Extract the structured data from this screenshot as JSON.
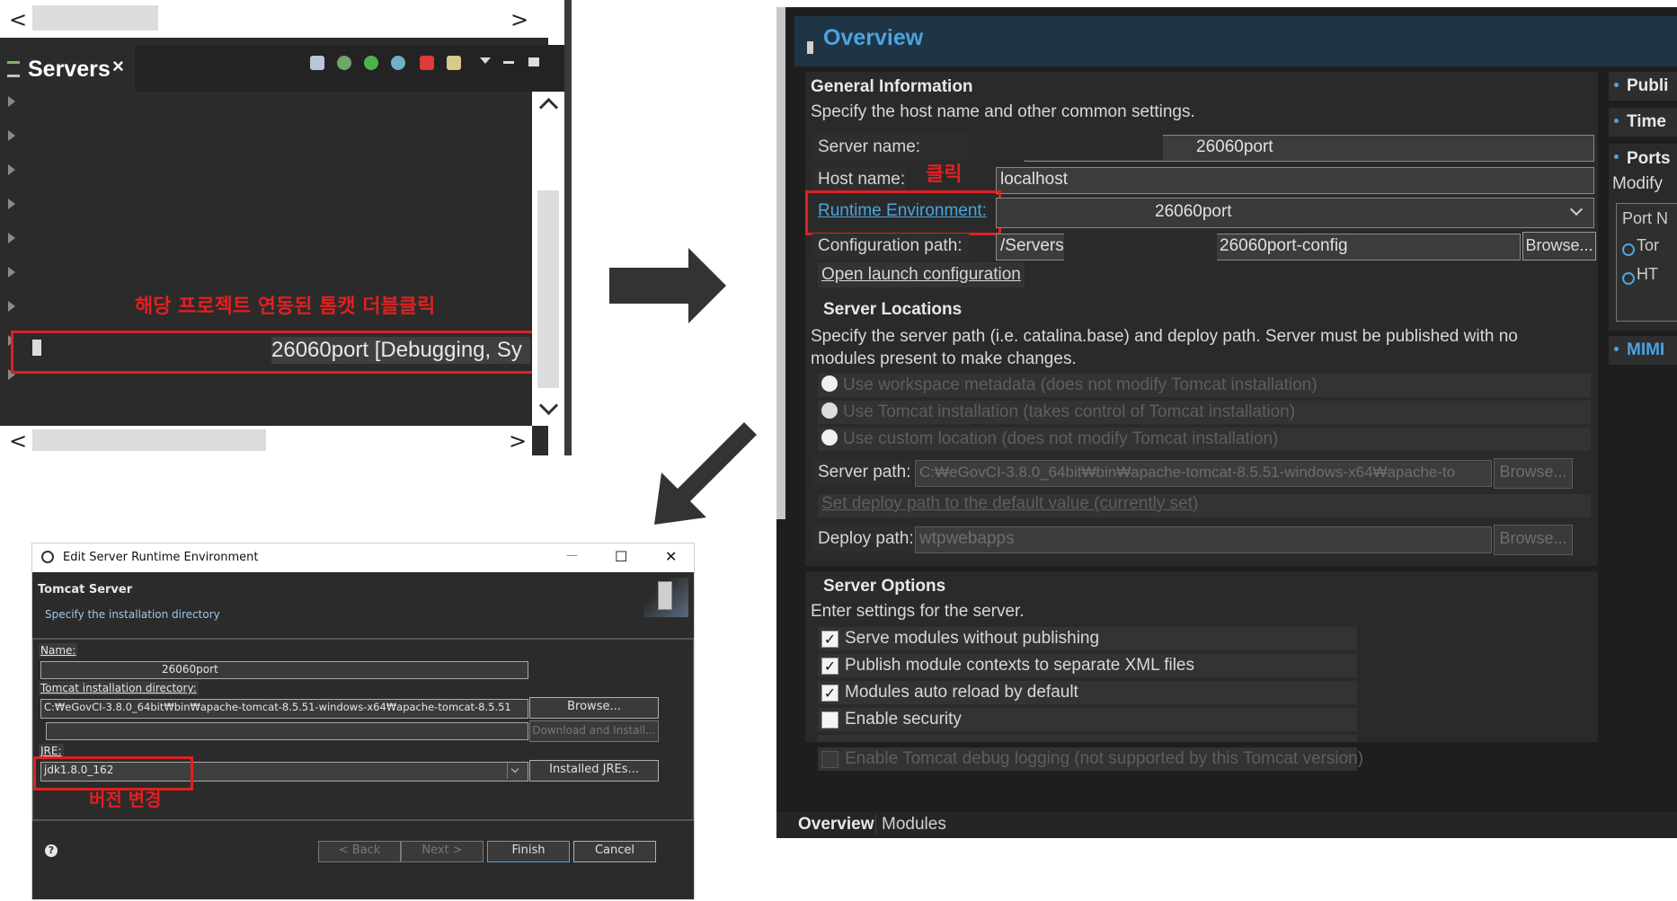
{
  "servers_view": {
    "tab_label": "Servers",
    "tab_close": "×",
    "server_entry": "26060port  [Debugging, Sy",
    "annotation": "해당 프로젝트 연동된 톰캣 더블클릭",
    "scroll_left": "<",
    "scroll_right": ">"
  },
  "overview": {
    "title": "Overview",
    "general": {
      "heading": "General Information",
      "desc": "Specify the host name and other common settings.",
      "server_name_label": "Server name:",
      "server_name_value": "26060port",
      "host_name_label": "Host name:",
      "host_name_value": "localhost",
      "runtime_env_label": "Runtime Environment:",
      "runtime_env_value": "26060port",
      "config_path_label": "Configuration path:",
      "config_path_value_prefix": "/Servers/",
      "config_path_value_suffix": "26060port-config",
      "browse_label": "Browse...",
      "open_launch_label": "Open launch configuration",
      "click_annotation": "클릭"
    },
    "locations": {
      "heading": "Server Locations",
      "desc": "Specify the server path (i.e. catalina.base) and deploy path. Server must be published with no modules present to make changes.",
      "opt_workspace": "Use workspace metadata (does not modify Tomcat installation)",
      "opt_tomcat": "Use Tomcat installation (takes control of Tomcat installation)",
      "opt_custom": "Use custom location (does not modify Tomcat installation)",
      "server_path_label": "Server path:",
      "server_path_value": "C:₩eGovCI-3.8.0_64bit₩bin₩apache-tomcat-8.5.51-windows-x64₩apache-to",
      "browse_label": "Browse...",
      "set_deploy_label": "Set deploy path to the default value (currently set)",
      "deploy_path_label": "Deploy path:",
      "deploy_path_value": "wtpwebapps",
      "browse2_label": "Browse..."
    },
    "options": {
      "heading": "Server Options",
      "desc": "Enter settings for the server.",
      "items": [
        {
          "label": "Serve modules without publishing",
          "checked": "✓"
        },
        {
          "label": "Publish module contexts to separate XML files",
          "checked": "✓"
        },
        {
          "label": "Modules auto reload by default",
          "checked": "✓"
        },
        {
          "label": "Enable security",
          "checked": ""
        },
        {
          "label": "Enable Tomcat debug logging (not supported by this Tomcat version)",
          "checked": ""
        }
      ]
    },
    "right": {
      "publishing": "Publi",
      "timeouts": "Time",
      "ports": "Ports",
      "modify": "Modify",
      "port_name_col": "Port N",
      "row1": "Tor",
      "row2": "HT",
      "mime": "MIMI"
    },
    "bottom_tabs": [
      "Overview",
      "Modules"
    ]
  },
  "dialog": {
    "window_title": "Edit Server Runtime Environment",
    "minimize": "—",
    "maximize": "☐",
    "close": "✕",
    "header_title": "Tomcat Server",
    "header_desc": "Specify the installation directory",
    "name_label": "Name:",
    "name_value": "26060port",
    "install_dir_label": "Tomcat installation directory:",
    "install_dir_value": "C:₩eGovCI-3.8.0_64bit₩bin₩apache-tomcat-8.5.51-windows-x64₩apache-tomcat-8.5.51",
    "browse_label": "Browse...",
    "download_label": "Download and Install...",
    "jre_label": "JRE:",
    "jre_value": "jdk1.8.0_162",
    "installed_jres_label": "Installed JREs...",
    "version_annotation": "버전 변경",
    "help": "?",
    "back_label": "< Back",
    "next_label": "Next >",
    "finish_label": "Finish",
    "cancel_label": "Cancel"
  },
  "colors": {
    "annotation_red": "#e02020",
    "dark_bg": "#2b2b2b",
    "link_blue": "#4ba3e0",
    "arrow": "#333333"
  }
}
